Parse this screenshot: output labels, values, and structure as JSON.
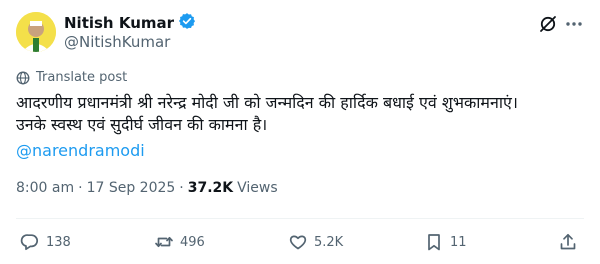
{
  "author": {
    "display_name": "Nitish Kumar",
    "handle": "@NitishKumar",
    "verified": true,
    "avatar_bg": "#f4e04a"
  },
  "header_actions": {
    "grok_icon": "grok-icon",
    "more_icon": "more-icon"
  },
  "translate_label": "Translate post",
  "post": {
    "line1": "आदरणीय प्रधानमंत्री श्री नरेन्द्र मोदी जी को जन्मदिन की हार्दिक बधाई एवं शुभकामनाएं।",
    "line2": "उनके स्वस्थ एवं सुदीर्घ जीवन की कामना है।",
    "mention": "@narendramodi"
  },
  "meta": {
    "time": "8:00 am",
    "date": "17 Sep 2025",
    "views": "37.2K",
    "views_label": "Views"
  },
  "actions": {
    "replies": "138",
    "reposts": "496",
    "likes": "5.2K",
    "bookmarks": "11"
  },
  "colors": {
    "text": "#0f1419",
    "secondary": "#536471",
    "link": "#1d9bf0",
    "verified_badge": "#1d9bf0"
  }
}
